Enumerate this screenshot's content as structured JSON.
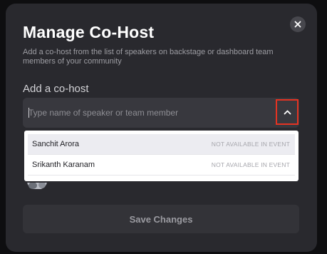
{
  "modal": {
    "title": "Manage Co-Host",
    "subtitle": "Add a co-host from the list of speakers on backstage or dashboard team members of your community",
    "close_icon": "close-icon"
  },
  "cohost": {
    "section_label": "Add a co-host",
    "input_placeholder": "Type name of speaker or team member",
    "input_value": "",
    "dropdown_icon": "chevron-up-icon",
    "options": [
      {
        "name": "Sanchit Arora",
        "status": "NOT AVAILABLE IN EVENT",
        "highlighted": true
      },
      {
        "name": "Srikanth Karanam",
        "status": "NOT AVAILABLE IN EVENT",
        "highlighted": false
      }
    ]
  },
  "footer": {
    "save_label": "Save Changes"
  },
  "colors": {
    "modal_bg": "#29292e",
    "input_bg": "#38383e",
    "highlight_border": "#e53322",
    "button_bg": "#333338"
  }
}
